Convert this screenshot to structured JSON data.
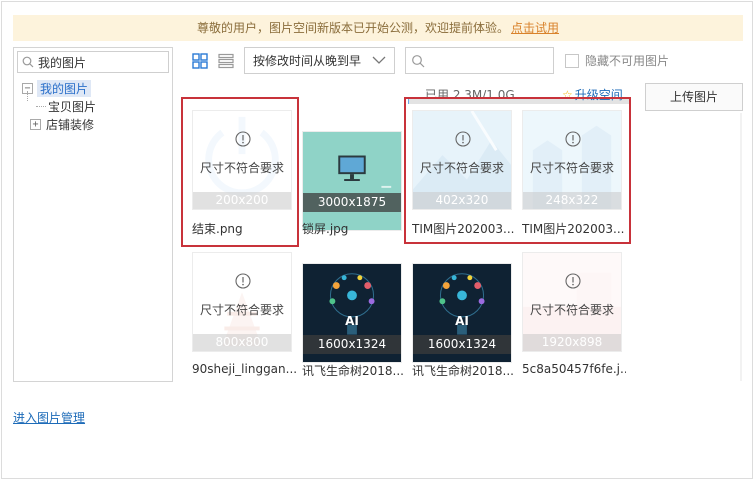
{
  "notice": {
    "text": "尊敬的用户，图片空间新版本已开始公测，欢迎提前体验。",
    "link": "点击试用"
  },
  "sidebar": {
    "search_value": "我的图片",
    "root": {
      "toggle": "−",
      "label": "我的图片"
    },
    "children": [
      {
        "toggle": "",
        "label": "宝贝图片"
      },
      {
        "toggle": "+",
        "label": "店铺装修"
      }
    ]
  },
  "toolbar": {
    "sort_value": "按修改时间从晚到早",
    "search_placeholder": "",
    "hide_label": "隐藏不可用图片"
  },
  "storage": {
    "usage": "已用 2.3M/1.0G",
    "used_fraction": 0.002,
    "upgrade": "升级空间",
    "upload": "上传图片"
  },
  "thumbnails": [
    {
      "file": "结束.png",
      "size": "200x200",
      "status": "尺寸不符合要求",
      "usable": false
    },
    {
      "file": "锁屏.jpg",
      "size": "3000x1875",
      "status": "",
      "usable": true
    },
    {
      "file": "TIM图片202003...",
      "size": "402x320",
      "status": "尺寸不符合要求",
      "usable": false
    },
    {
      "file": "TIM图片202003...",
      "size": "248x322",
      "status": "尺寸不符合要求",
      "usable": false
    },
    {
      "file": "90sheji_linggan...",
      "size": "800x800",
      "status": "尺寸不符合要求",
      "usable": false
    },
    {
      "file": "讯飞生命树2018...",
      "size": "1600x1324",
      "status": "",
      "usable": true,
      "overlay_text": "AI"
    },
    {
      "file": "讯飞生命树2018...",
      "size": "1600x1324",
      "status": "",
      "usable": true,
      "overlay_text": "AI"
    },
    {
      "file": "5c8a50457f6fe.j...",
      "size": "1920x898",
      "status": "尺寸不符合要求",
      "usable": false
    }
  ],
  "footer": {
    "manage_link": "进入图片管理"
  },
  "colors": {
    "accent": "#1d6bb8",
    "highlight": "#c8323a",
    "notice_bg": "#fdf3dc",
    "link_orange": "#d9822b"
  }
}
